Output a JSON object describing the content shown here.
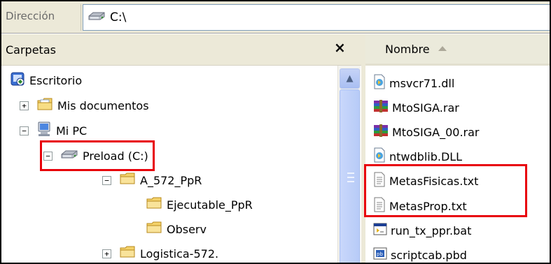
{
  "address_bar": {
    "label": "Dirección",
    "path": "C:\\"
  },
  "folders": {
    "title": "Carpetas",
    "close_symbol": "×",
    "items": [
      {
        "label": "Escritorio",
        "icon": "desktop-icon",
        "toggle": ""
      },
      {
        "label": "Mis documentos",
        "icon": "folder-documents-icon",
        "toggle": "+"
      },
      {
        "label": "Mi PC",
        "icon": "my-computer-icon",
        "toggle": "−"
      },
      {
        "label": "Preload (C:)",
        "icon": "hard-drive-icon",
        "toggle": "−",
        "highlighted": true
      },
      {
        "label": "A_572_PpR",
        "icon": "folder-icon",
        "toggle": "−"
      },
      {
        "label": "Ejecutable_PpR",
        "icon": "folder-icon",
        "toggle": ""
      },
      {
        "label": "Observ",
        "icon": "folder-icon",
        "toggle": ""
      },
      {
        "label": "Logistica-572.",
        "icon": "folder-icon",
        "toggle": "+"
      }
    ]
  },
  "files": {
    "column_name": "Nombre",
    "items": [
      {
        "name": "msvcr71.dll",
        "icon": "dll-icon"
      },
      {
        "name": "MtoSIGA.rar",
        "icon": "rar-icon"
      },
      {
        "name": "MtoSIGA_00.rar",
        "icon": "rar-icon"
      },
      {
        "name": "ntwdblib.DLL",
        "icon": "dll-icon"
      },
      {
        "name": "MetasFisicas.txt",
        "icon": "text-file-icon",
        "highlighted": true
      },
      {
        "name": "MetasProp.txt",
        "icon": "text-file-icon",
        "highlighted": true
      },
      {
        "name": "run_tx_ppr.bat",
        "icon": "batch-file-icon"
      },
      {
        "name": "scriptcab.pbd",
        "icon": "pbd-file-icon"
      }
    ]
  },
  "colors": {
    "highlight": "#e8000b",
    "chrome": "#ece9d8",
    "folder": "#f4d26a"
  }
}
